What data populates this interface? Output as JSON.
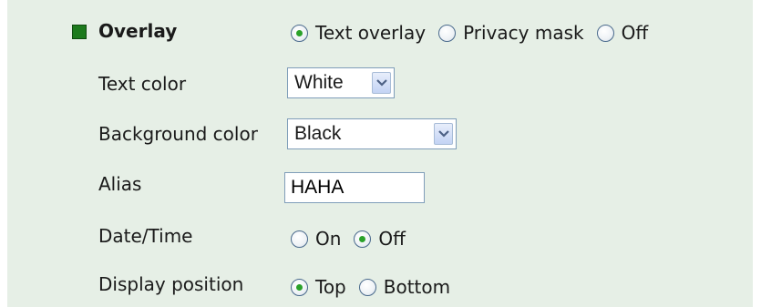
{
  "overlay": {
    "title": "Overlay",
    "mode_options": [
      {
        "label": "Text overlay",
        "checked": true
      },
      {
        "label": "Privacy mask",
        "checked": false
      },
      {
        "label": "Off",
        "checked": false
      }
    ]
  },
  "text_color": {
    "label": "Text color",
    "value": "White"
  },
  "background_color": {
    "label": "Background color",
    "value": "Black"
  },
  "alias": {
    "label": "Alias",
    "value": "HAHA"
  },
  "date_time": {
    "label": "Date/Time",
    "options": [
      {
        "label": "On",
        "checked": false
      },
      {
        "label": "Off",
        "checked": true
      }
    ]
  },
  "display_position": {
    "label": "Display position",
    "options": [
      {
        "label": "Top",
        "checked": true
      },
      {
        "label": "Bottom",
        "checked": false
      }
    ]
  },
  "colors": {
    "panel_bg": "#e6efe6",
    "section_marker": "#1d7a1d",
    "radio_dot": "#2aa12a"
  }
}
